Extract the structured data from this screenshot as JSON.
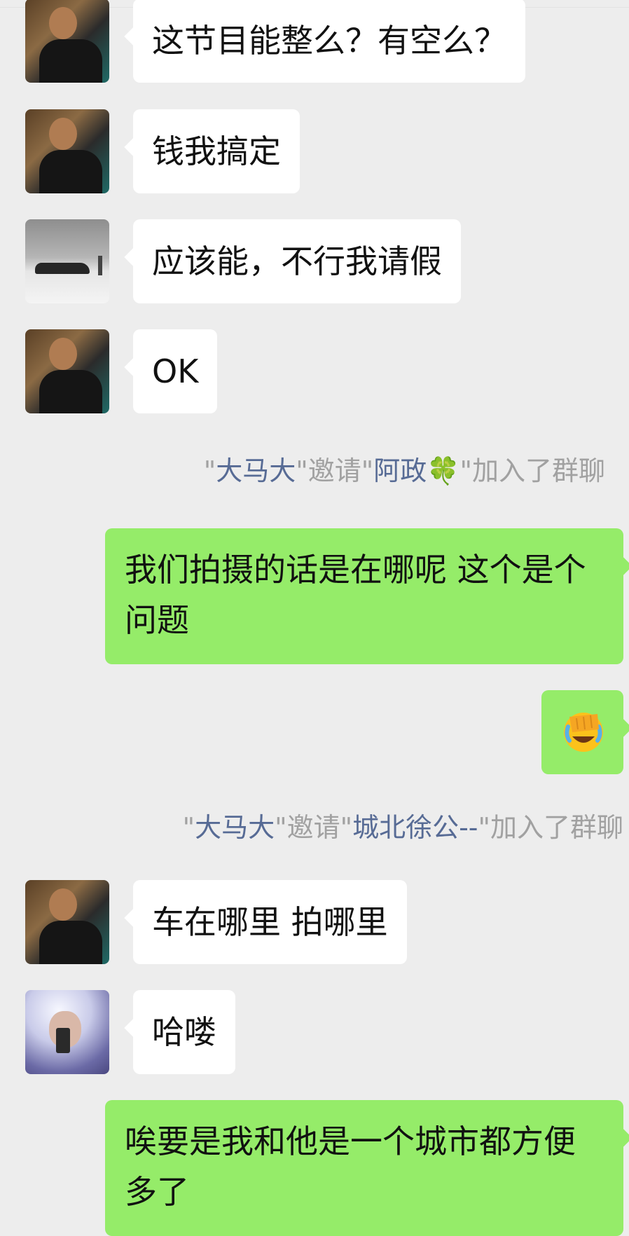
{
  "messages": [
    {
      "type": "incoming",
      "avatar": "selfie-avatar",
      "text": "这节目能整么？有空么？"
    },
    {
      "type": "incoming",
      "avatar": "selfie-avatar",
      "text": "钱我搞定"
    },
    {
      "type": "incoming",
      "avatar": "car-avatar",
      "text": "应该能，不行我请假"
    },
    {
      "type": "incoming",
      "avatar": "selfie-avatar",
      "text": "OK"
    },
    {
      "type": "system",
      "q1": "\"",
      "inviter": "大马大",
      "q2": "\"邀请\"",
      "invitee": "阿政🍀",
      "q3": "\"加入了群聊"
    },
    {
      "type": "outgoing",
      "text": "我们拍摄的话是在哪呢  这个是个问题"
    },
    {
      "type": "outgoing",
      "emoji": "facepalm-laugh-emoji"
    },
    {
      "type": "system",
      "q1": "\"",
      "inviter": "大马大",
      "q2": "\"邀请\"",
      "invitee": "城北徐公--",
      "q3": "\"加入了群聊"
    },
    {
      "type": "incoming",
      "avatar": "selfie-avatar",
      "text": "车在哪里 拍哪里"
    },
    {
      "type": "incoming",
      "avatar": "person-avatar",
      "text": "哈喽"
    },
    {
      "type": "outgoing",
      "text": "唉要是我和他是一个城市都方便多了"
    }
  ],
  "colors": {
    "background": "#ededed",
    "incoming_bubble": "#ffffff",
    "outgoing_bubble": "#95ec69",
    "system_text": "#a1a1a1",
    "system_name": "#576b95"
  }
}
